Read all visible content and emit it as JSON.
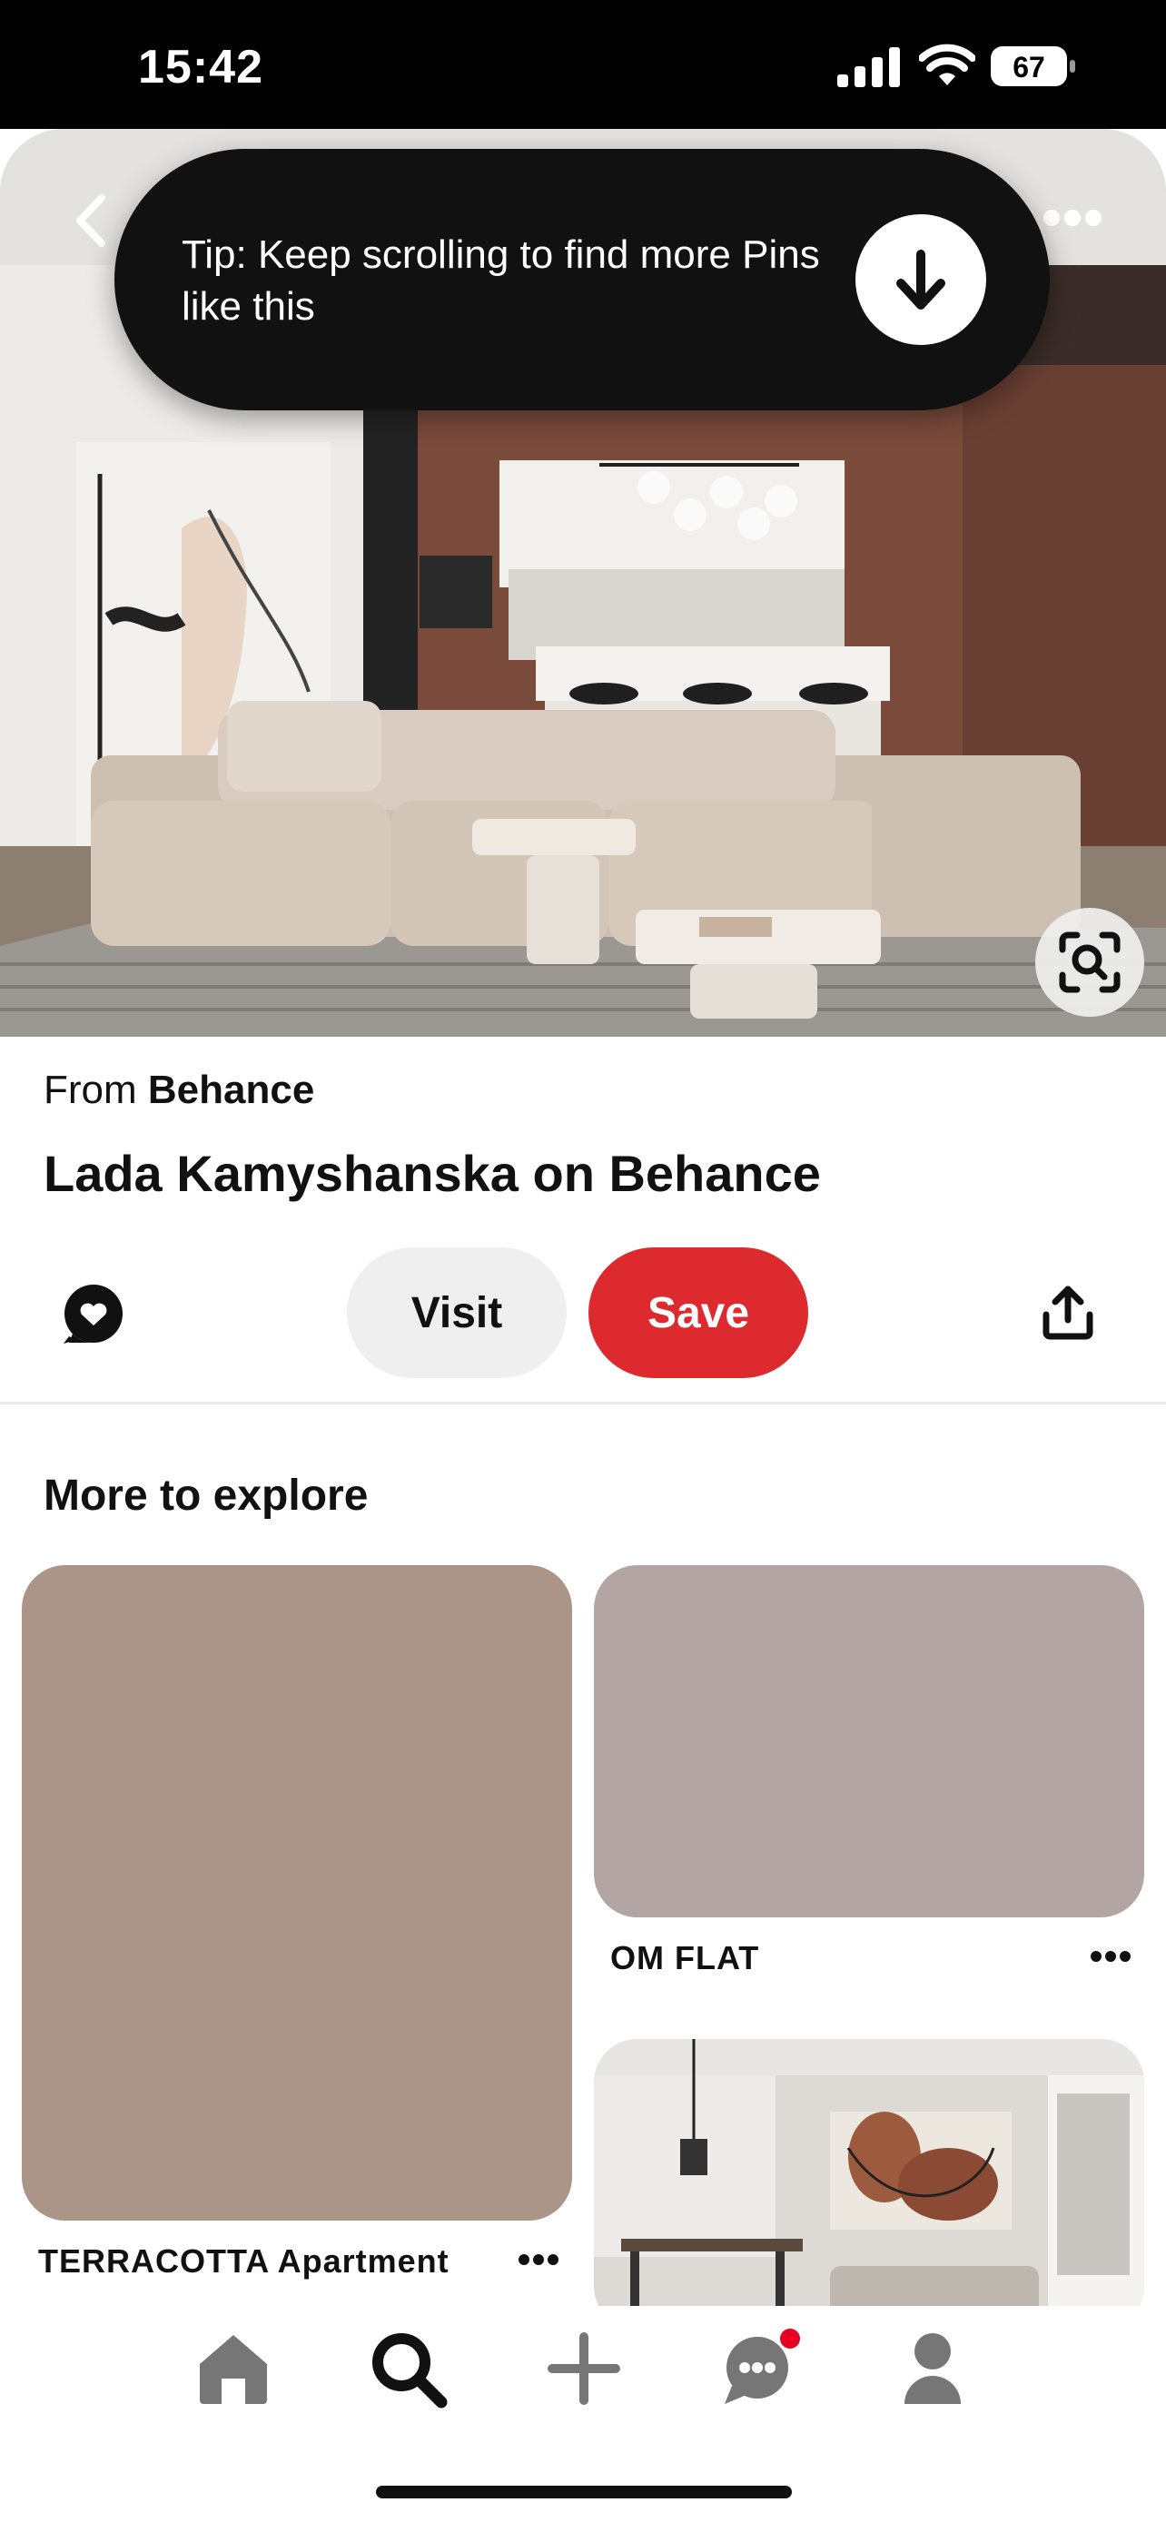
{
  "status_bar": {
    "time": "15:42",
    "battery_level": "67",
    "icons": [
      "signal-icon",
      "wifi-icon",
      "battery-icon"
    ]
  },
  "hero": {
    "image_description_icon": "interior-photo",
    "top_icons": [
      "back-icon",
      "more-icon"
    ],
    "lens_icon": "visual-search-icon"
  },
  "tip": {
    "text": "Tip: Keep scrolling to find more Pins like this",
    "button_icon": "arrow-down-icon"
  },
  "pin": {
    "from_prefix": "From",
    "from_source": "Behance",
    "title": "Lada Kamyshanska on Behance"
  },
  "actions": {
    "comment_icon": "comment-heart-icon",
    "visit_label": "Visit",
    "save_label": "Save",
    "share_icon": "share-icon"
  },
  "explore": {
    "heading": "More to explore",
    "cards": [
      {
        "label": "TERRACOTTA Apartment",
        "color": "#ab9488"
      },
      {
        "label": "OM FLAT",
        "color": "#b2a5a3"
      },
      {
        "label": "",
        "color": "#d9d6d2"
      }
    ]
  },
  "tabbar": {
    "tabs": [
      "home-icon",
      "search-icon",
      "create-icon",
      "messages-icon",
      "profile-icon"
    ],
    "active": "search-icon",
    "notification_color": "#e60023"
  },
  "colors": {
    "save": "#dd2a2f",
    "tip_bg": "#111111"
  }
}
